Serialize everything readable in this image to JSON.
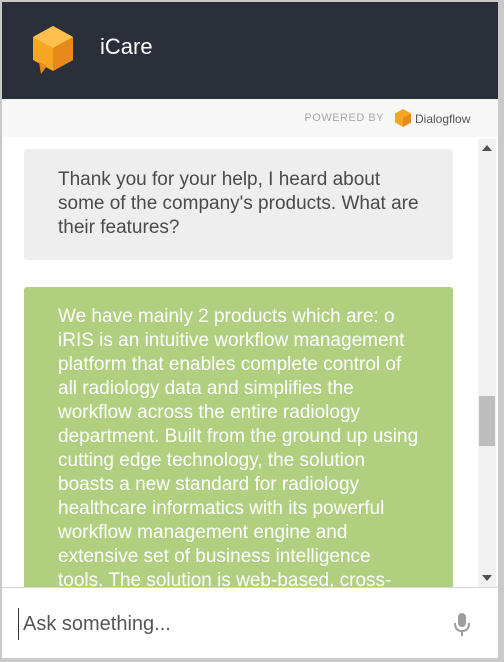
{
  "header": {
    "title": "iCare"
  },
  "powered": {
    "label": "POWERED BY",
    "brand": "Dialogflow"
  },
  "messages": {
    "user": "Thank you for your help, I heard about some of the company's products. What are their features?",
    "bot": "We have mainly 2 products which are: o iRIS is an intuitive workflow management platform that enables complete control of all radiology data and simplifies the workflow across the entire radiology department. Built from the ground up using cutting edge technology, the solution boasts a new standard for radiology healthcare informatics with its powerful workflow management engine and extensive set of business intelligence tools. The solution is web-based, cross-"
  },
  "input": {
    "placeholder": "Ask something..."
  },
  "colors": {
    "header_bg": "#2b2f3a",
    "bot_bubble": "#b0d07f",
    "user_bubble": "#eeeeee",
    "brand_orange": "#f5a623"
  },
  "icons": {
    "logo": "orange-cube-chat-icon",
    "dialogflow": "dialogflow-logo-icon",
    "mic": "microphone-icon"
  }
}
